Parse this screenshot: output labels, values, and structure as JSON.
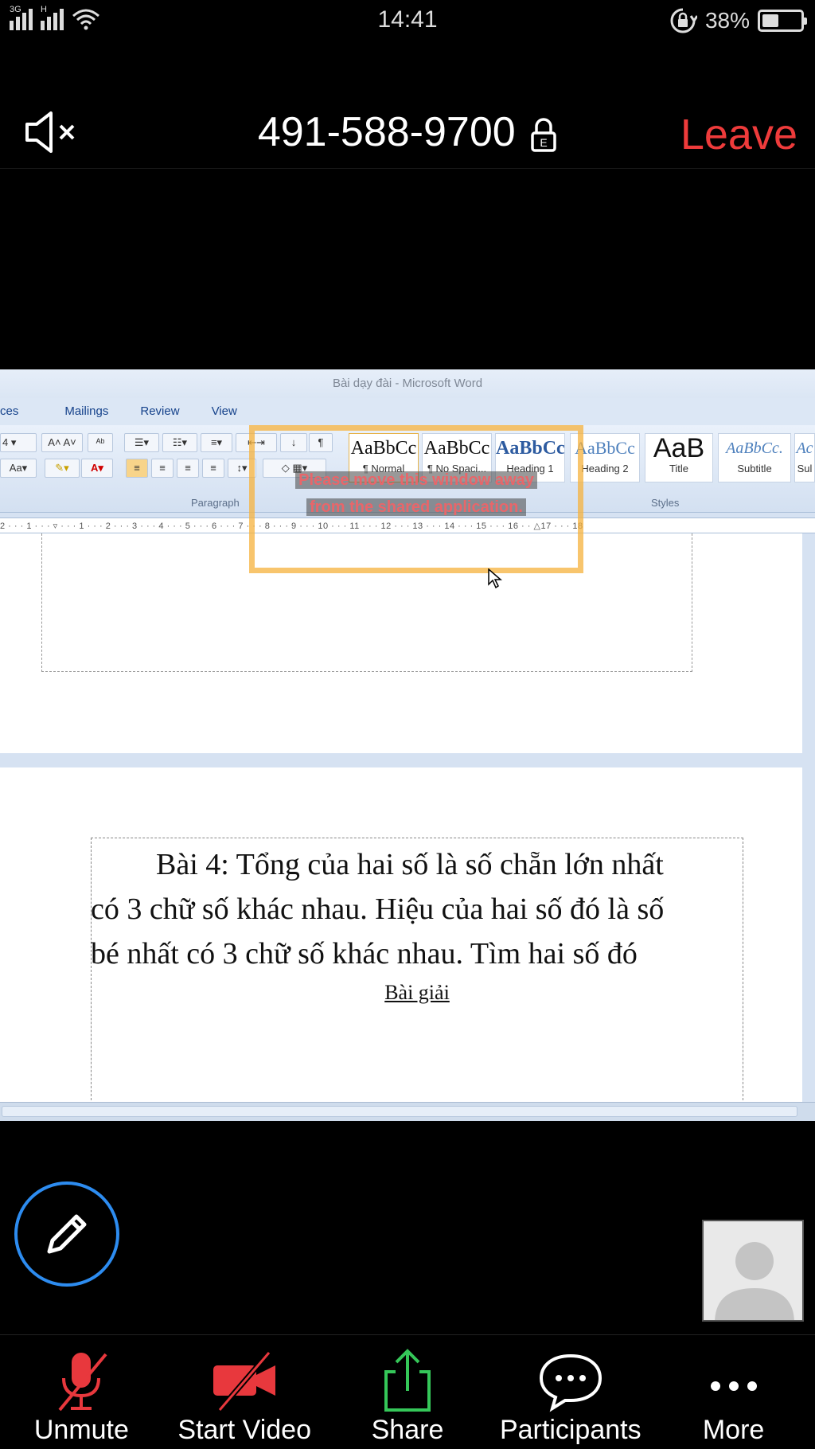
{
  "status_bar": {
    "network_left": "3G",
    "network_right": "H",
    "time": "14:41",
    "battery_percent": "38%",
    "battery_level": 0.38
  },
  "meeting": {
    "meeting_id": "491-588-9700",
    "leave_label": "Leave"
  },
  "shared_screen": {
    "window_title": "Bài dạy đài - Microsoft Word",
    "ribbon_tabs": [
      "ces",
      "Mailings",
      "Review",
      "View"
    ],
    "font_size_value": "4",
    "group_labels": {
      "paragraph": "Paragraph",
      "styles": "Styles"
    },
    "styles": [
      {
        "sample": "AaBbCc",
        "name": "¶ Normal"
      },
      {
        "sample": "AaBbCc",
        "name": "¶ No Spaci..."
      },
      {
        "sample": "AaBbCc",
        "name": "Heading 1"
      },
      {
        "sample": "AaBbCc",
        "name": "Heading 2"
      },
      {
        "sample": "AaB",
        "name": "Title"
      },
      {
        "sample": "AaBbCc.",
        "name": "Subtitle"
      },
      {
        "sample": "Ac",
        "name": "Sul"
      }
    ],
    "ruler_text": "2 · · · 1 · · · ▿ · · · 1 · · · 2 · · · 3 · · · 4 · · · 5 · · · 6 · · · 7 · · · 8 · · · 9 · · · 10 · · · 11 · · · 12 · · · 13 · · · 14 · · · 15 · · · 16 · · △17 · · · 18",
    "overlay_message_line1": "Please move this window away",
    "overlay_message_line2": "from the shared application.",
    "document": {
      "line1": "Bài 4:  Tổng của hai số là số chẵn lớn nhất",
      "line2": "có 3 chữ số khác nhau.  Hiệu của hai số đó là số",
      "line3": "bé nhất có 3 chữ số khác nhau.  Tìm hai số đó",
      "heading": "Bài giải"
    }
  },
  "toolbar": {
    "unmute": "Unmute",
    "start_video": "Start Video",
    "share": "Share",
    "participants": "Participants",
    "more": "More"
  },
  "colors": {
    "leave": "#ee3b3b",
    "muted_red": "#e8383d",
    "share_green": "#35c759",
    "annotate_blue": "#2d8cf0",
    "overlay_orange": "#f5b23c"
  }
}
